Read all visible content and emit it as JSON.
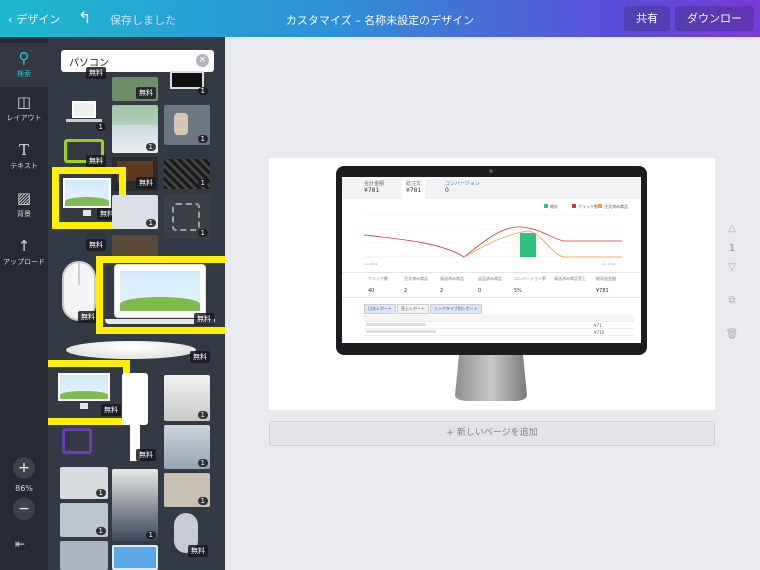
{
  "topbar": {
    "back_label": "デザイン",
    "saved_status": "保存しました",
    "document_title": "カスタマイズ – 名称未設定のデザイン",
    "share_label": "共有",
    "download_label": "ダウンロード"
  },
  "sidebar": {
    "items": [
      {
        "label": "検索",
        "icon": "search-icon"
      },
      {
        "label": "レイアウト",
        "icon": "layout-icon"
      },
      {
        "label": "テキスト",
        "icon": "text-icon"
      },
      {
        "label": "背景",
        "icon": "background-icon"
      },
      {
        "label": "アップロード",
        "icon": "upload-icon"
      }
    ],
    "zoom_in": "+",
    "zoom_level": "86%",
    "zoom_out": "−"
  },
  "search": {
    "query": "パソコン"
  },
  "results": {
    "free_label": "無料",
    "count_label": "1"
  },
  "dashboard": {
    "kpis": [
      {
        "label": "合計金額",
        "value": "¥781"
      },
      {
        "label": "総注文",
        "value": "¥781"
      },
      {
        "label": "コンバージョン",
        "value": "0"
      }
    ],
    "stats": [
      {
        "label": "クリック数",
        "value": "40"
      },
      {
        "label": "注文済み商品",
        "value": "2"
      },
      {
        "label": "発送済み商品",
        "value": "2"
      },
      {
        "label": "返品済み商品",
        "value": "0"
      },
      {
        "label": "コンバージョン率",
        "value": "5%"
      },
      {
        "label": "発送済み商品売上",
        "value": ""
      },
      {
        "label": "総収益金額",
        "value": "¥781"
      }
    ],
    "tabs": [
      "日次レポート",
      "売上レポート",
      "リンクタイプ別レポート"
    ],
    "table_rows": [
      [
        "",
        "",
        "",
        "",
        "¥71"
      ],
      [
        "",
        "",
        "",
        "",
        "¥710"
      ]
    ],
    "legend": [
      "総計",
      "クリック数",
      "注文済み商品"
    ]
  },
  "canvas": {
    "add_page_label": "+ 新しいページを追加",
    "page_number": "1"
  },
  "colors": {
    "accent": "#25c4d8",
    "highlight": "#ffef00",
    "panel": "#343a45",
    "toolbar": "#262a33"
  }
}
